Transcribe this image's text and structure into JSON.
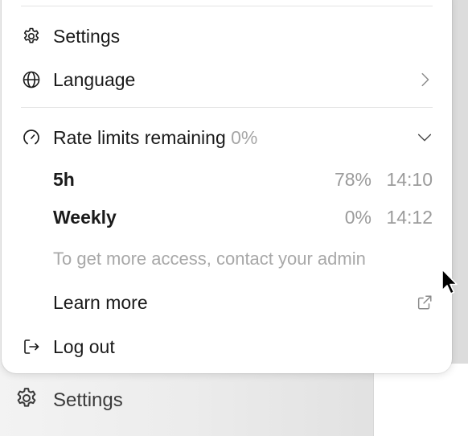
{
  "background": {
    "settings_label": "Settings"
  },
  "menu": {
    "settings_label": "Settings",
    "language_label": "Language",
    "rate_limits": {
      "label": "Rate limits remaining",
      "value": "0%",
      "items": [
        {
          "name": "5h",
          "percent": "78%",
          "time": "14:10"
        },
        {
          "name": "Weekly",
          "percent": "0%",
          "time": "14:12"
        }
      ],
      "note": "To get more access, contact your admin"
    },
    "learn_more_label": "Learn more",
    "logout_label": "Log out"
  },
  "icons": {
    "settings": "gear-icon",
    "language": "globe-icon",
    "language_arrow": "chevron-right-icon",
    "rate_limits": "gauge-icon",
    "rate_limits_toggle": "chevron-down-icon",
    "learn_more": "external-link-icon",
    "logout": "logout-icon"
  }
}
